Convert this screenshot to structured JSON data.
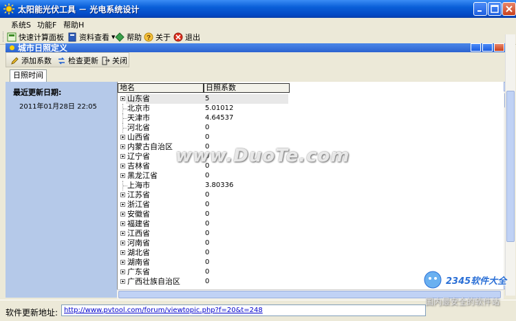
{
  "window": {
    "title": "太阳能光伏工具 － 光电系统设计"
  },
  "menu": [
    "系统S",
    "功能F",
    "帮助H"
  ],
  "toolbar": {
    "quick_calc": "快速计算面板",
    "resources": "资料查看",
    "help": "帮助",
    "about": "关于",
    "exit": "退出"
  },
  "child": {
    "title": "城市日照定义",
    "toolbar": {
      "add": "添加系数",
      "check_update": "检查更新",
      "close": "关闭"
    },
    "tab": "日照时间",
    "last_update_label": "最近更新日期:",
    "last_update_value": "2011年01月28日 22:05",
    "grid": {
      "columns": [
        "地名",
        "日照系数"
      ],
      "rows": [
        {
          "name": "山东省",
          "coef": "5",
          "expandable": true,
          "selected": true
        },
        {
          "name": "北京市",
          "coef": "5.01012",
          "expandable": false
        },
        {
          "name": "天津市",
          "coef": "4.64537",
          "expandable": false
        },
        {
          "name": "河北省",
          "coef": "0",
          "expandable": false
        },
        {
          "name": "山西省",
          "coef": "0",
          "expandable": true
        },
        {
          "name": "内蒙古自治区",
          "coef": "0",
          "expandable": true
        },
        {
          "name": "辽宁省",
          "coef": "0",
          "expandable": true
        },
        {
          "name": "吉林省",
          "coef": "0",
          "expandable": true
        },
        {
          "name": "黑龙江省",
          "coef": "0",
          "expandable": true
        },
        {
          "name": "上海市",
          "coef": "3.80336",
          "expandable": false
        },
        {
          "name": "江苏省",
          "coef": "0",
          "expandable": true
        },
        {
          "name": "浙江省",
          "coef": "0",
          "expandable": true
        },
        {
          "name": "安徽省",
          "coef": "0",
          "expandable": true
        },
        {
          "name": "福建省",
          "coef": "0",
          "expandable": true
        },
        {
          "name": "江西省",
          "coef": "0",
          "expandable": true
        },
        {
          "name": "河南省",
          "coef": "0",
          "expandable": true
        },
        {
          "name": "湖北省",
          "coef": "0",
          "expandable": true
        },
        {
          "name": "湖南省",
          "coef": "0",
          "expandable": true
        },
        {
          "name": "广东省",
          "coef": "0",
          "expandable": true
        },
        {
          "name": "广西壮族自治区",
          "coef": "0",
          "expandable": true
        }
      ]
    }
  },
  "status": {
    "label": "软件更新地址:",
    "url": "http://www.pvtool.com/forum/viewtopic.php?f=20&t=248"
  },
  "watermark": {
    "text": "www.DuoTe.com",
    "badge_top": "2345软件大全",
    "badge_bottom": "国内最安全的软件站"
  }
}
